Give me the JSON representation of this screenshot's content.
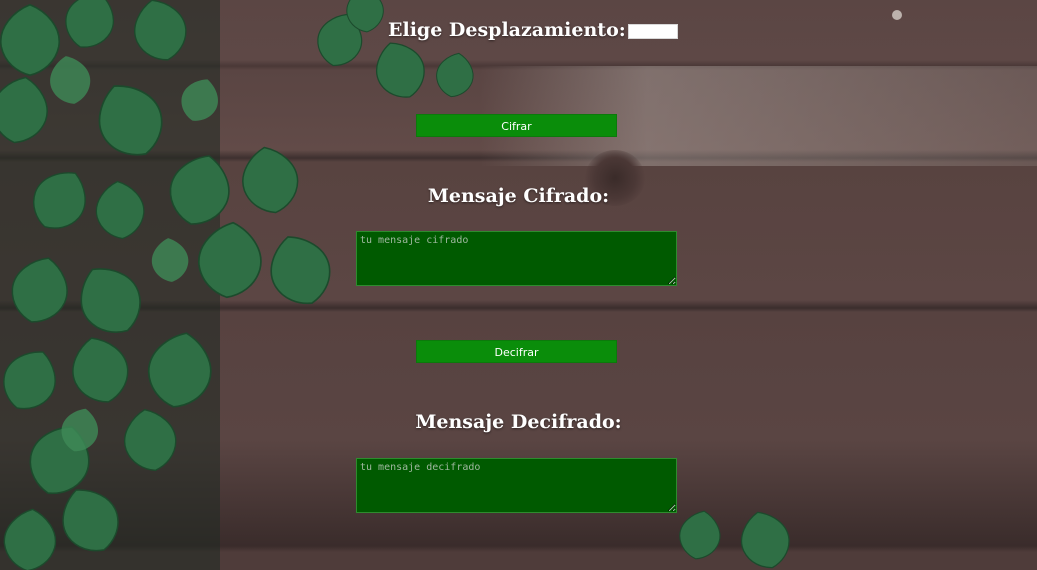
{
  "shift": {
    "label": "Elige Desplazamiento:",
    "value": ""
  },
  "cipher_button": {
    "label": "Cifrar"
  },
  "encrypted": {
    "heading": "Mensaje Cifrado:",
    "placeholder": "tu mensaje cifrado"
  },
  "decipher_button": {
    "label": "Decifrar"
  },
  "decrypted": {
    "heading": "Mensaje Decifrado:",
    "placeholder": "tu mensaje decifrado"
  },
  "colors": {
    "button_bg": "#0a8d0a",
    "textarea_bg": "#005a00",
    "text": "#ffffff"
  }
}
